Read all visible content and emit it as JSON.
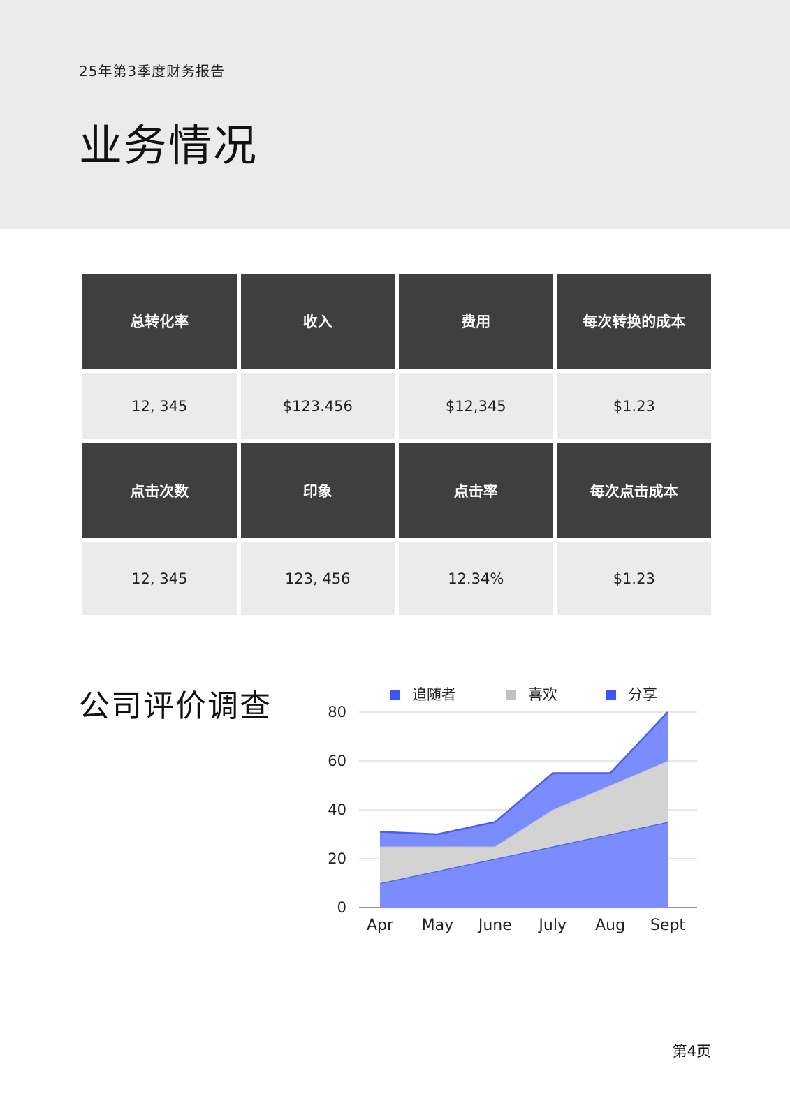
{
  "header": {
    "report_label": "25年第3季度财务报告",
    "title": "业务情况"
  },
  "metrics": {
    "row1": [
      {
        "label": "总转化率",
        "value": "12, 345"
      },
      {
        "label": "收入",
        "value": "$123.456"
      },
      {
        "label": "费用",
        "value": "$12,345"
      },
      {
        "label": "每次转换的成本",
        "value": "$1.23"
      }
    ],
    "row2": [
      {
        "label": "点击次数",
        "value": "12, 345"
      },
      {
        "label": "印象",
        "value": "123, 456"
      },
      {
        "label": "点击率",
        "value": "12.34%"
      },
      {
        "label": "每次点击成本",
        "value": "$1.23"
      }
    ]
  },
  "survey": {
    "title": "公司评价调查"
  },
  "chart_data": {
    "type": "area",
    "stacked": true,
    "categories": [
      "Apr",
      "May",
      "June",
      "July",
      "Aug",
      "Sept"
    ],
    "ylim": [
      0,
      80
    ],
    "yticks": [
      0,
      20,
      40,
      60,
      80
    ],
    "grid": true,
    "legend_position": "top",
    "series": [
      {
        "name": "追随者",
        "color": "#7b8cff",
        "legend_color": "#3b56f5",
        "values": [
          10,
          15,
          20,
          25,
          30,
          35
        ]
      },
      {
        "name": "喜欢",
        "color": "#d3d3d3",
        "legend_color": "#c0c0c0",
        "values": [
          15,
          10,
          5,
          15,
          20,
          25
        ]
      },
      {
        "name": "分享",
        "color": "#7b8cff",
        "legend_color": "#3b56f5",
        "values": [
          6,
          5,
          10,
          15,
          5,
          20
        ]
      }
    ]
  },
  "footer": {
    "page_number": "第4页"
  }
}
